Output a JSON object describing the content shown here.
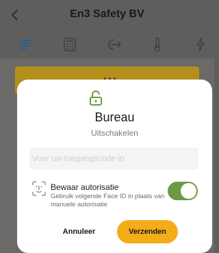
{
  "header": {
    "title": "En3 Safety BV",
    "back_icon": "chevron-left-icon"
  },
  "icon_bar": {
    "items": [
      {
        "icon": "list-icon",
        "active": true
      },
      {
        "icon": "keypad-icon",
        "active": false
      },
      {
        "icon": "exit-icon",
        "active": false
      },
      {
        "icon": "thermometer-icon",
        "active": false
      },
      {
        "icon": "lightning-icon",
        "active": false
      }
    ]
  },
  "colors": {
    "accent": "#f4ac1b",
    "active_icon": "#2e5f8a",
    "lock_icon": "#6a9a46",
    "toggle_on": "#6a9a46"
  },
  "dialog": {
    "lock_icon": "unlocked-icon",
    "zone_name": "Bureau",
    "action": "Uitschakelen",
    "code_input": {
      "placeholder": "Voer uw toegangscode in",
      "value": ""
    },
    "authorization": {
      "icon": "face-id-icon",
      "title": "Bewaar autorisatie",
      "description": "Gebruik volgende Face ID in plaats van manuele autorisatie",
      "enabled": true
    },
    "cancel_label": "Annuleer",
    "submit_label": "Verzenden"
  }
}
